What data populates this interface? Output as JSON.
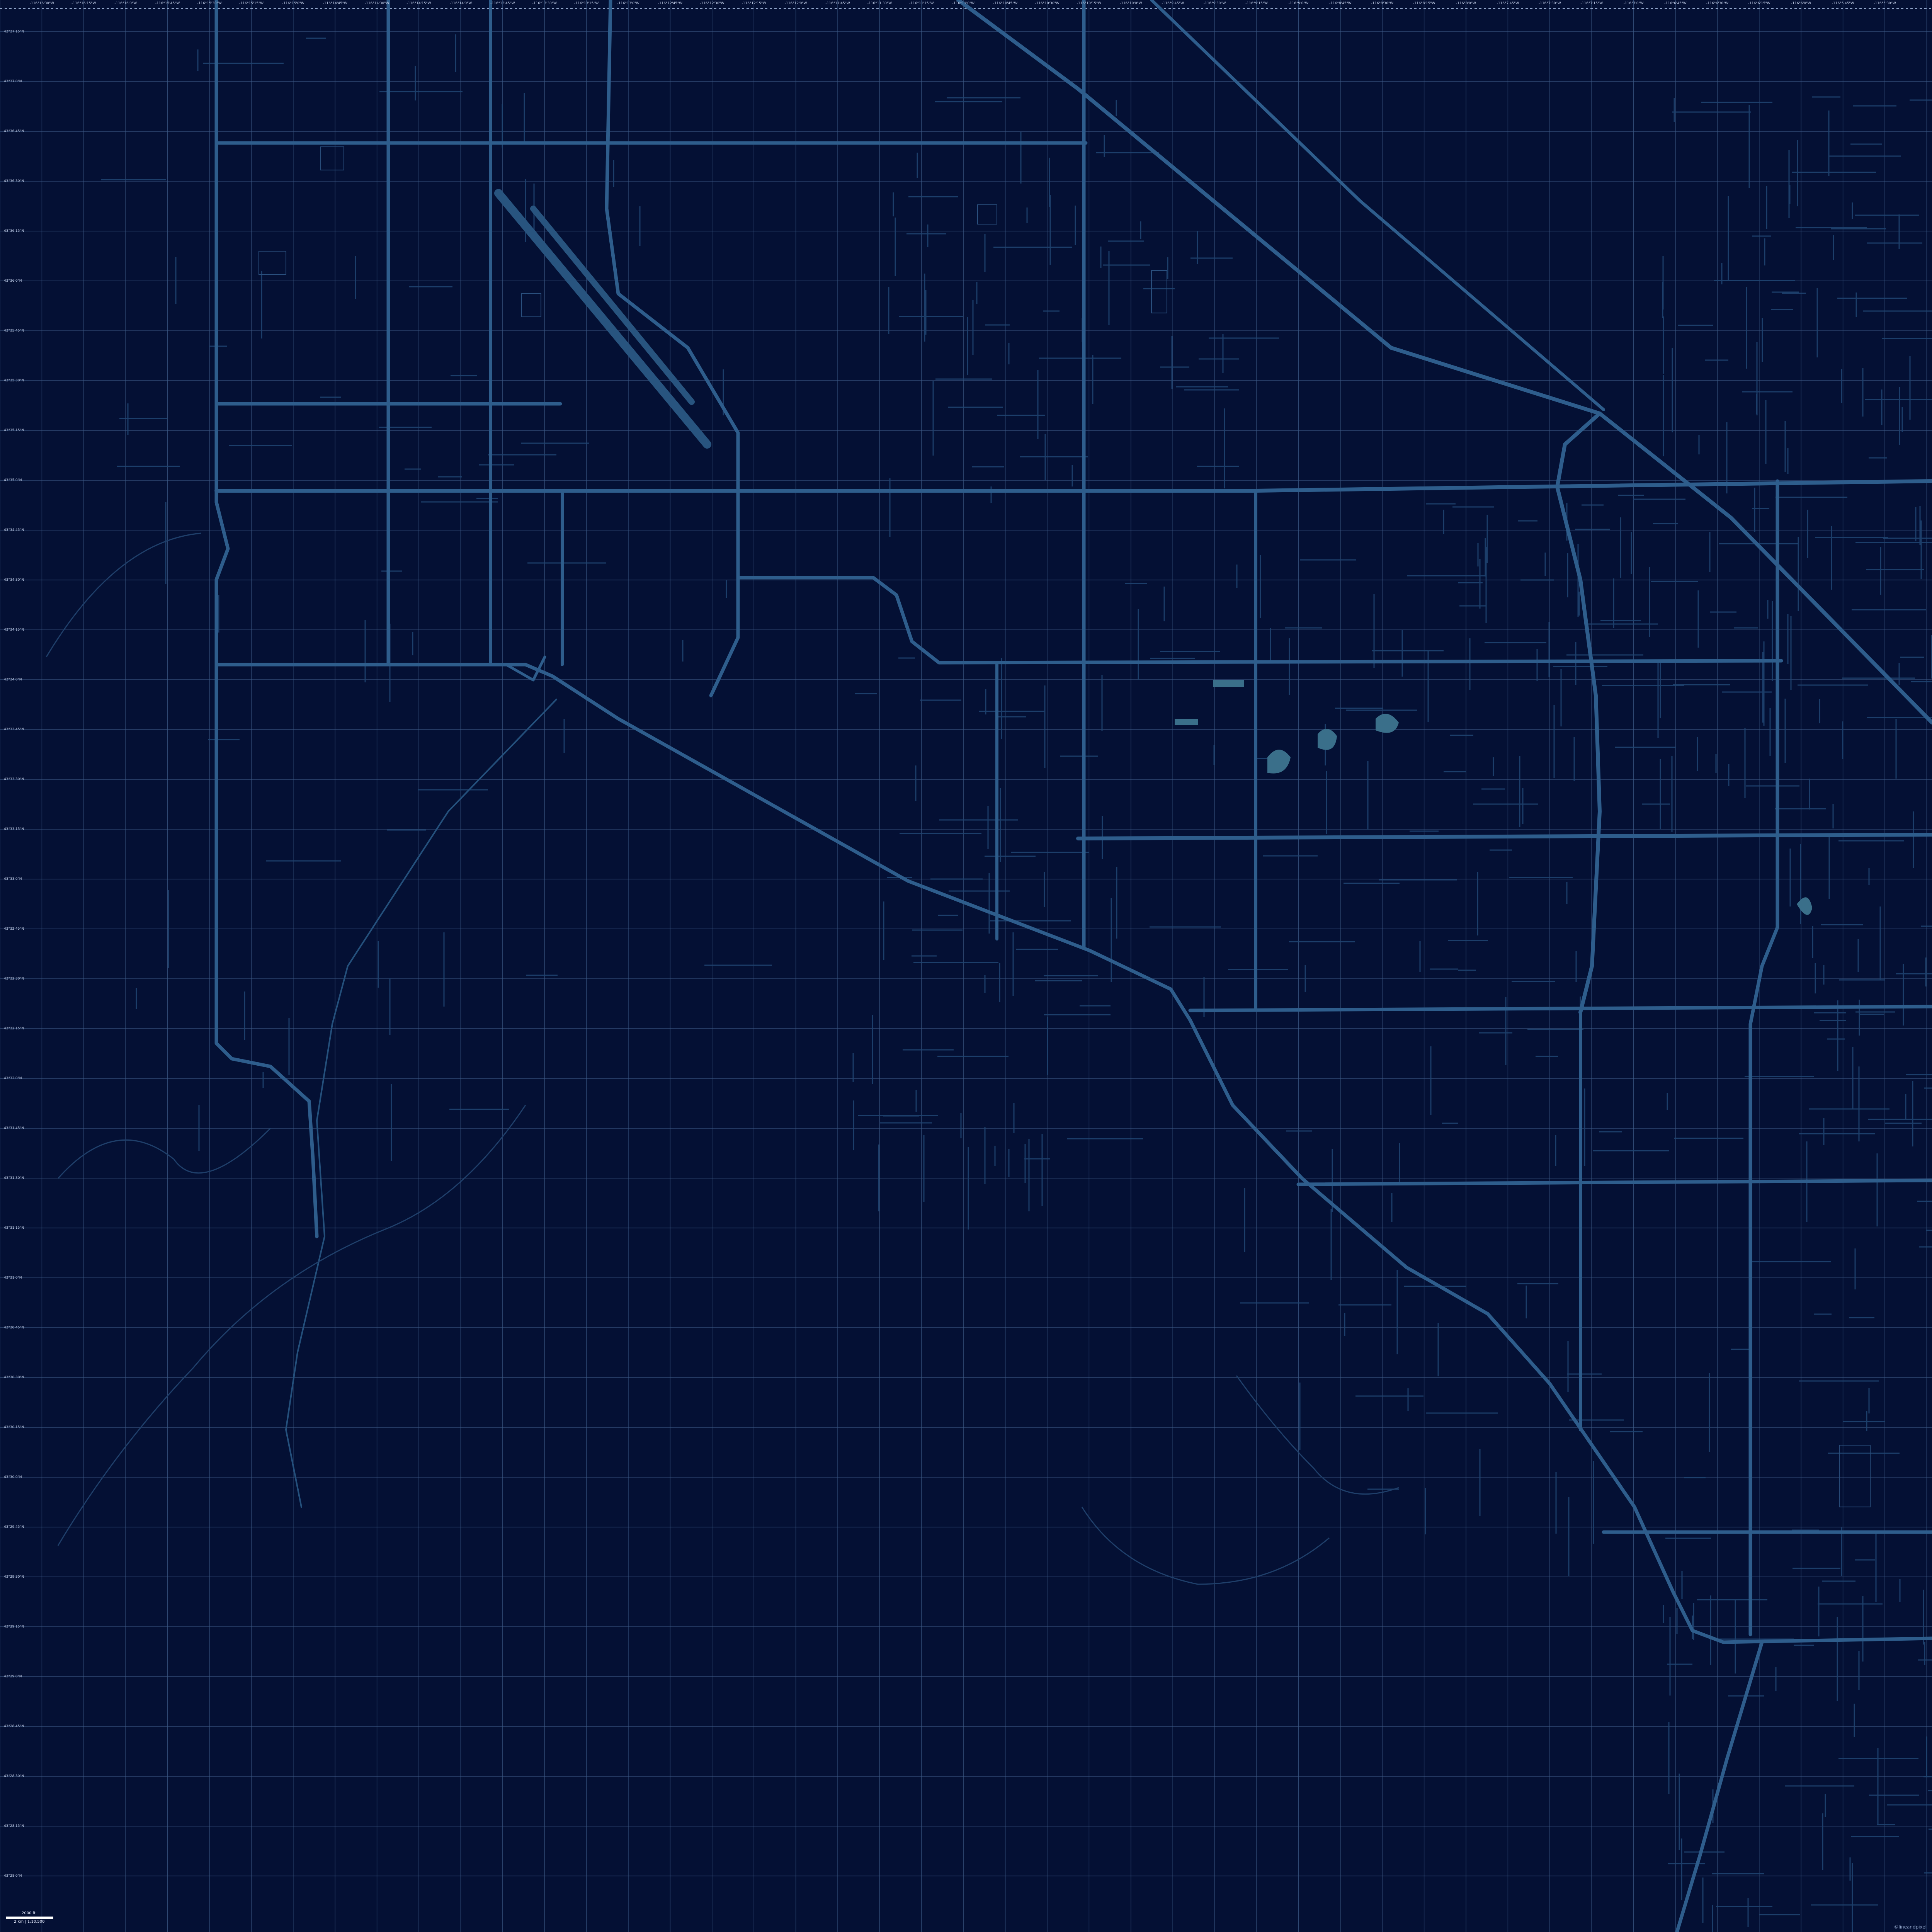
{
  "map": {
    "title": "",
    "colors": {
      "background": "#041034",
      "grid": "#3d5a86",
      "major_road": "#2e5d8c",
      "minor_road": "#1f4470",
      "water": "#3a6f8a",
      "label": "#c8d4ee"
    },
    "grid_columns": 46,
    "grid_rows": 38,
    "top_ticks": [
      "-116°16'30\"W",
      "-116°16'15\"W",
      "-116°16'0\"W",
      "-116°15'45\"W",
      "-116°15'30\"W",
      "-116°15'15\"W",
      "-116°15'0\"W",
      "-116°14'45\"W",
      "-116°14'30\"W",
      "-116°14'15\"W",
      "-116°14'0\"W",
      "-116°13'45\"W",
      "-116°13'30\"W",
      "-116°13'15\"W",
      "-116°13'0\"W",
      "-116°12'45\"W",
      "-116°12'30\"W",
      "-116°12'15\"W",
      "-116°12'0\"W",
      "-116°11'45\"W",
      "-116°11'30\"W",
      "-116°11'15\"W",
      "-116°11'0\"W",
      "-116°10'45\"W",
      "-116°10'30\"W",
      "-116°10'15\"W",
      "-116°10'0\"W",
      "-116°9'45\"W",
      "-116°9'30\"W",
      "-116°9'15\"W",
      "-116°9'0\"W",
      "-116°8'45\"W",
      "-116°8'30\"W",
      "-116°8'15\"W",
      "-116°8'0\"W",
      "-116°7'45\"W",
      "-116°7'30\"W",
      "-116°7'15\"W",
      "-116°7'0\"W",
      "-116°6'45\"W",
      "-116°6'30\"W",
      "-116°6'15\"W",
      "-116°6'0\"W",
      "-116°5'45\"W",
      "-116°5'30\"W"
    ],
    "left_ticks": [
      "43°37'15\"N",
      "43°37'0\"N",
      "43°36'45\"N",
      "43°36'30\"N",
      "43°36'15\"N",
      "43°36'0\"N",
      "43°35'45\"N",
      "43°35'30\"N",
      "43°35'15\"N",
      "43°35'0\"N",
      "43°34'45\"N",
      "43°34'30\"N",
      "43°34'15\"N",
      "43°34'0\"N",
      "43°33'45\"N",
      "43°33'30\"N",
      "43°33'15\"N",
      "43°33'0\"N",
      "43°32'45\"N",
      "43°32'30\"N",
      "43°32'15\"N",
      "43°32'0\"N",
      "43°31'45\"N",
      "43°31'30\"N",
      "43°31'15\"N",
      "43°31'0\"N",
      "43°30'45\"N",
      "43°30'30\"N",
      "43°30'15\"N",
      "43°30'0\"N",
      "43°29'45\"N",
      "43°29'30\"N",
      "43°29'15\"N",
      "43°29'0\"N",
      "43°28'45\"N",
      "43°28'30\"N",
      "43°28'15\"N",
      "43°28'0\"N"
    ],
    "scale": {
      "top_label": "2000 ft",
      "bottom_label": "2 km | 1:10,500"
    },
    "attribution": "©lineandpixel"
  }
}
